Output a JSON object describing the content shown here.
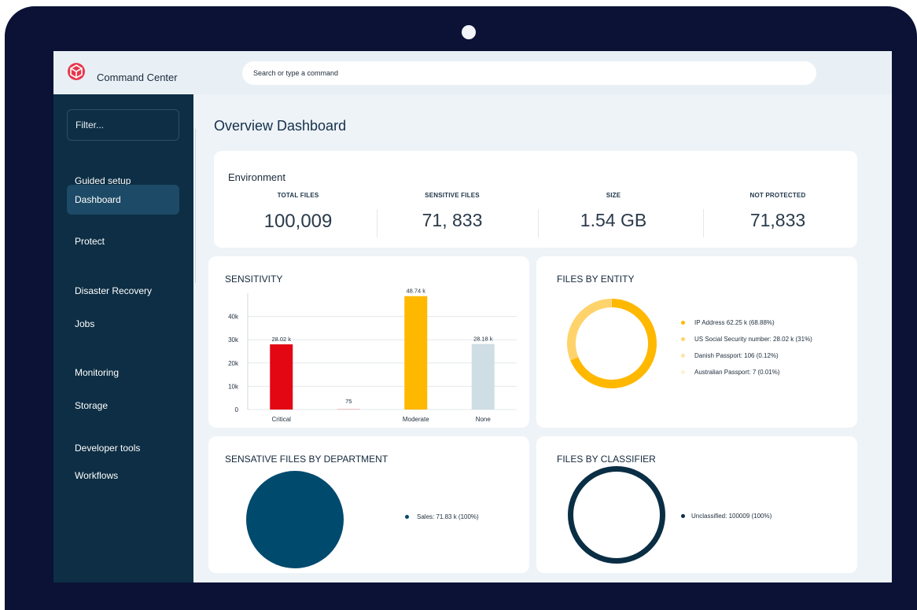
{
  "app": {
    "title": "Command Center"
  },
  "search": {
    "placeholder": "Search or type a command"
  },
  "sidebar": {
    "filter_label": "Filter...",
    "items": [
      {
        "label": "Guided setup"
      },
      {
        "label": "Dashboard"
      },
      {
        "label": "Protect"
      },
      {
        "label": "Disaster Recovery"
      },
      {
        "label": "Jobs"
      },
      {
        "label": "Monitoring"
      },
      {
        "label": "Storage"
      },
      {
        "label": "Developer tools"
      },
      {
        "label": "Workflows"
      }
    ]
  },
  "page": {
    "title": "Overview Dashboard"
  },
  "environment": {
    "title": "Environment",
    "kpis": [
      {
        "label": "TOTAL FILES",
        "value": "100,009"
      },
      {
        "label": "SENSITIVE FILES",
        "value": "71, 833"
      },
      {
        "label": "SIZE",
        "value": "1.54 GB"
      },
      {
        "label": "NOT PROTECTED",
        "value": "71,833"
      }
    ]
  },
  "sensitivity": {
    "title": "SENSITIVITY",
    "chart_data": {
      "type": "bar",
      "categories": [
        "Critical",
        "",
        "Moderate",
        "None"
      ],
      "values": [
        28020,
        75,
        48740,
        28180
      ],
      "data_labels": [
        "28.02 k",
        "75",
        "48.74 k",
        "28.18 k"
      ],
      "colors": [
        "#e30613",
        "#e30613",
        "#ffb800",
        "#cfdde4"
      ],
      "yticks": [
        "0",
        "10k",
        "20k",
        "30k",
        "40k"
      ],
      "ytick_values": [
        0,
        10000,
        20000,
        30000,
        40000
      ],
      "ylim": [
        0,
        50000
      ],
      "title": "SENSITIVITY"
    }
  },
  "files_by_entity": {
    "title": "FILES BY ENTITY",
    "chart_data": {
      "type": "pie",
      "labels": [
        "IP Address",
        "US Social Security number",
        "Danish Passport",
        "Australian Passport"
      ],
      "values": [
        62250,
        28020,
        106,
        7
      ],
      "colors": [
        "#ffb800",
        "#ffd36b",
        "#ffe3a8",
        "#fff0d4"
      ],
      "legend": [
        "IP Address 62.25 k (68.88%)",
        "US Social Security number: 28.02 k (31%)",
        "Danish Passport: 106 (0.12%)",
        "Australian Passport: 7 (0.01%)"
      ]
    }
  },
  "department": {
    "title": "SENSATIVE FILES BY DEPARTMENT",
    "chart_data": {
      "type": "pie",
      "labels": [
        "Sales"
      ],
      "values": [
        71830
      ],
      "colors": [
        "#004a6e"
      ],
      "legend": [
        "Sales: 71.83 k (100%)"
      ]
    }
  },
  "classifier": {
    "title": "FILES BY CLASSIFIER",
    "chart_data": {
      "type": "pie",
      "labels": [
        "Unclassified"
      ],
      "values": [
        100009
      ],
      "colors": [
        "#0a2e44"
      ],
      "legend": [
        "Unclassified: 100009 (100%)"
      ]
    }
  },
  "colors": {
    "frame": "#0b1236",
    "sidebar": "#0d2e44",
    "sidebar_active": "#1d4a66",
    "accent_yellow": "#ffb800",
    "accent_red": "#e30613"
  }
}
